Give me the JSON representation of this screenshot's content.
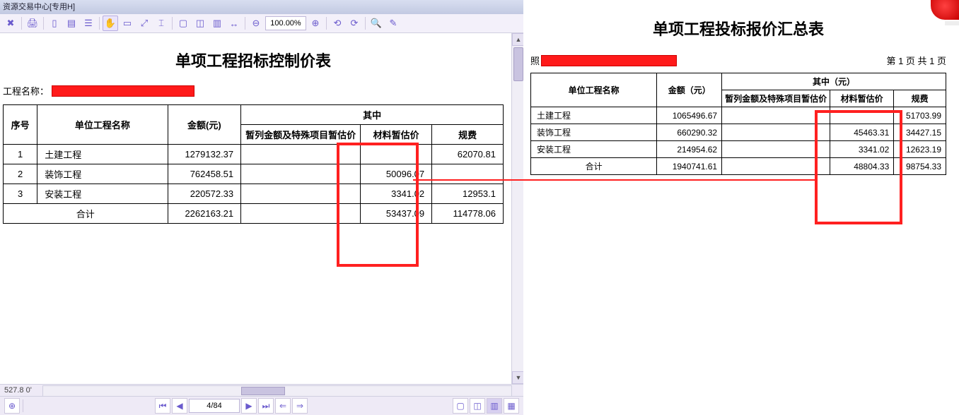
{
  "app": {
    "title": "资源交易中心[专用H]"
  },
  "toolbar": {
    "zoom": "100.00%"
  },
  "nav": {
    "page": "4/84"
  },
  "status": {
    "coords": "527.8 0'"
  },
  "leftDoc": {
    "title": "单项工程招标控制价表",
    "projectLabel": "工程名称：",
    "headers": {
      "seq": "序号",
      "name": "单位工程名称",
      "amount": "金额(元)",
      "mid": "其中",
      "col1": "暂列金额及特殊项目暂估价",
      "col2": "材料暂估价",
      "col3": "规费"
    },
    "rows": [
      {
        "seq": "1",
        "name": "土建工程",
        "amount": "1279132.37",
        "c1": "",
        "c2": "",
        "c3": "62070.81"
      },
      {
        "seq": "2",
        "name": "装饰工程",
        "amount": "762458.51",
        "c1": "",
        "c2": "50096.07",
        "c3": ""
      },
      {
        "seq": "3",
        "name": "安装工程",
        "amount": "220572.33",
        "c1": "",
        "c2": "3341.02",
        "c3": "12953.1"
      }
    ],
    "total": {
      "label": "合计",
      "amount": "2262163.21",
      "c1": "",
      "c2": "53437.09",
      "c3": "114778.06"
    }
  },
  "rightDoc": {
    "title": "单项工程投标报价汇总表",
    "prefix": "照",
    "pageInfo": "第 1 页   共 1 页",
    "headers": {
      "name": "单位工程名称",
      "amount": "金额（元）",
      "mid": "其中（元）",
      "col1": "暂列金额及特殊项目暂估价",
      "col2": "材料暂估价",
      "col3": "规费"
    },
    "rows": [
      {
        "name": "土建工程",
        "amount": "1065496.67",
        "c1": "",
        "c2": "",
        "c3": "51703.99"
      },
      {
        "name": "装饰工程",
        "amount": "660290.32",
        "c1": "",
        "c2": "45463.31",
        "c3": "34427.15"
      },
      {
        "name": "安装工程",
        "amount": "214954.62",
        "c1": "",
        "c2": "3341.02",
        "c3": "12623.19"
      }
    ],
    "total": {
      "label": "合计",
      "amount": "1940741.61",
      "c1": "",
      "c2": "48804.33",
      "c3": "98754.33"
    }
  }
}
